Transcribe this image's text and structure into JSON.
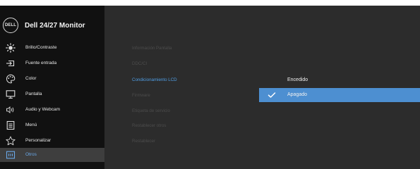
{
  "monitor_menu": {
    "brand_logo": "DELL",
    "model_title": "Dell 24/27 Monitor",
    "nav": [
      {
        "label": "Brillo/Contraste",
        "icon": "brightness-icon"
      },
      {
        "label": "Fuente entrada",
        "icon": "input-source-icon"
      },
      {
        "label": "Color",
        "icon": "color-palette-icon"
      },
      {
        "label": "Pantalla",
        "icon": "display-icon"
      },
      {
        "label": "Audio y Webcam",
        "icon": "audio-webcam-icon"
      },
      {
        "label": "Menú",
        "icon": "menu-icon"
      },
      {
        "label": "Personalizar",
        "icon": "star-icon"
      },
      {
        "label": "Otros",
        "icon": "other-icon",
        "active": true
      }
    ],
    "submenu": [
      {
        "label": "Información Pantalla"
      },
      {
        "label": "DDC/CI"
      },
      {
        "label": "Condicionamiento LCD",
        "active": true
      },
      {
        "label": "Firmware"
      },
      {
        "label": "Etiqueta de servicio"
      },
      {
        "label": "Restablecer otros"
      },
      {
        "label": "Restablecer"
      }
    ],
    "options": [
      {
        "label": "Encedido",
        "selected": false
      },
      {
        "label": "Apagado",
        "selected": true,
        "icon": "checkmark-icon"
      }
    ]
  },
  "colors": {
    "sidebar_bg": "#111111",
    "panel_bg": "#2c2c2c",
    "active_nav_bg": "#3e3e3e",
    "active_text": "#4f9ee5",
    "selected_option_bg": "#4d8fd1"
  }
}
